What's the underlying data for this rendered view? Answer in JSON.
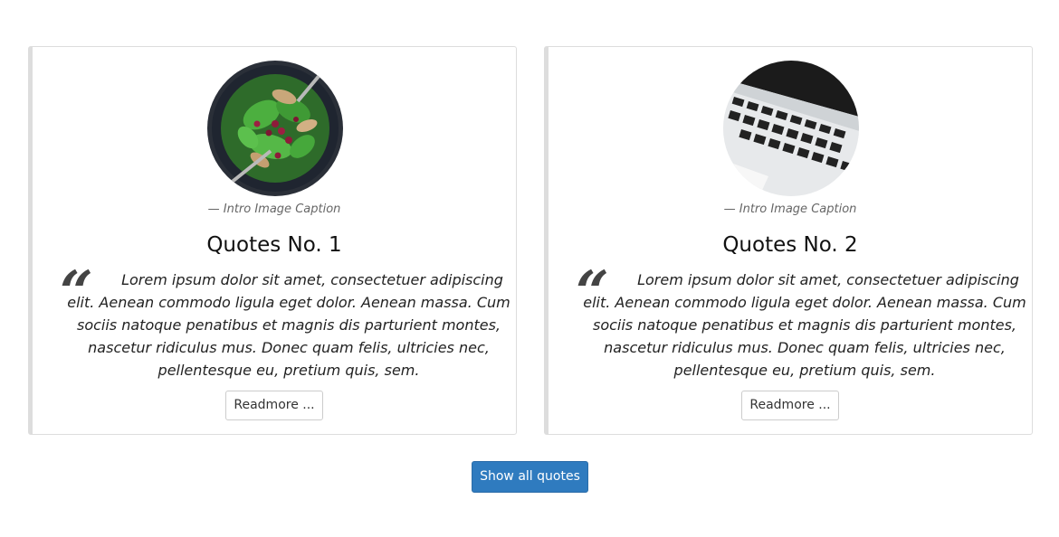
{
  "quotes": [
    {
      "image_name": "salad-bowl-image",
      "caption": "— Intro Image Caption",
      "title": "Quotes No. 1",
      "quote_mark": "“",
      "text": "Lorem ipsum dolor sit amet, consectetuer adipiscing elit. Aenean commodo ligula eget dolor. Aenean massa. Cum sociis natoque penatibus et magnis dis parturient montes, nascetur ridiculus mus. Donec quam felis, ultricies nec, pellentesque eu, pretium quis, sem.",
      "button_label": "Readmore ..."
    },
    {
      "image_name": "laptop-keyboard-image",
      "caption": "— Intro Image Caption",
      "title": "Quotes No. 2",
      "quote_mark": "“",
      "text": "Lorem ipsum dolor sit amet, consectetuer adipiscing elit. Aenean commodo ligula eget dolor. Aenean massa. Cum sociis natoque penatibus et magnis dis parturient montes, nascetur ridiculus mus. Donec quam felis, ultricies nec, pellentesque eu, pretium quis, sem.",
      "button_label": "Readmore ..."
    }
  ],
  "show_all_label": "Show all quotes",
  "colors": {
    "primary_button": "#2f7bbf",
    "card_border": "#dddddd",
    "quote_mark": "#444444"
  }
}
